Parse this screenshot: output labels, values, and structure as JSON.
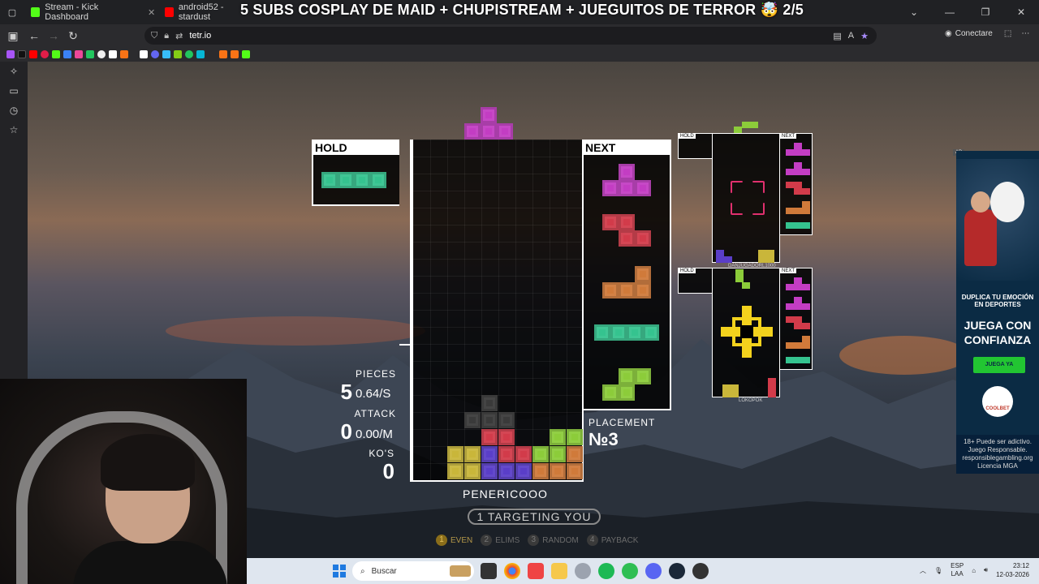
{
  "browser": {
    "tabs": [
      {
        "label": "Stream - Kick Dashboard",
        "color": "#53fc18"
      },
      {
        "label": "android52 - stardust",
        "color": "#ff0000"
      }
    ],
    "stream_title": "5 SUBS COSPLAY DE MAID + CHUPISTREAM + JUEGUITOS DE TERROR 🤯 2/5",
    "url": "tetr.io",
    "connect_label": "Conectare"
  },
  "game": {
    "hold_label": "HOLD",
    "next_label": "NEXT",
    "stats": {
      "pieces_label": "PIECES",
      "pieces_value": "5",
      "pieces_rate": "0.64/S",
      "attack_label": "ATTACK",
      "attack_value": "0",
      "attack_rate": "0.00/M",
      "kos_label": "KO'S",
      "kos_value": "0"
    },
    "placement_label": "PLACEMENT",
    "placement_value": "№3",
    "username": "PENERICOOO",
    "targeting_text": "1 TARGETING YOU",
    "strategies": [
      {
        "num": "1",
        "label": "EVEN"
      },
      {
        "num": "2",
        "label": "ELIMS"
      },
      {
        "num": "3",
        "label": "RANDOM"
      },
      {
        "num": "4",
        "label": "PAYBACK"
      }
    ],
    "opponents": [
      {
        "hold": "HOLD",
        "next": "NEXT",
        "name": "DANJUGADORL1000"
      },
      {
        "hold": "HOLD",
        "next": "NEXT",
        "name": "LOKOPOK"
      }
    ],
    "colors": {
      "T": "#c33dc3",
      "Z": "#d23b4a",
      "L": "#d07a3a",
      "I": "#35c38f",
      "S": "#8ccc3a",
      "O": "#c9b63a",
      "J": "#5a3ec8",
      "G": "#3a3a3a"
    }
  },
  "ad": {
    "tag": "AD",
    "line1": "DUPLICA TU EMOCIÓN EN DEPORTES",
    "line2": "JUEGA CON CONFIANZA",
    "button": "JUEGA YA",
    "brand": "COOLBET",
    "disclaimer": "18+ Puede ser adictivo. Juego Responsable. responsiblegambling.org Licencia MGA"
  },
  "taskbar": {
    "search_placeholder": "Buscar",
    "lang_top": "ESP",
    "lang_bottom": "LAA",
    "time": "23:12",
    "date": "12-03-2026"
  }
}
